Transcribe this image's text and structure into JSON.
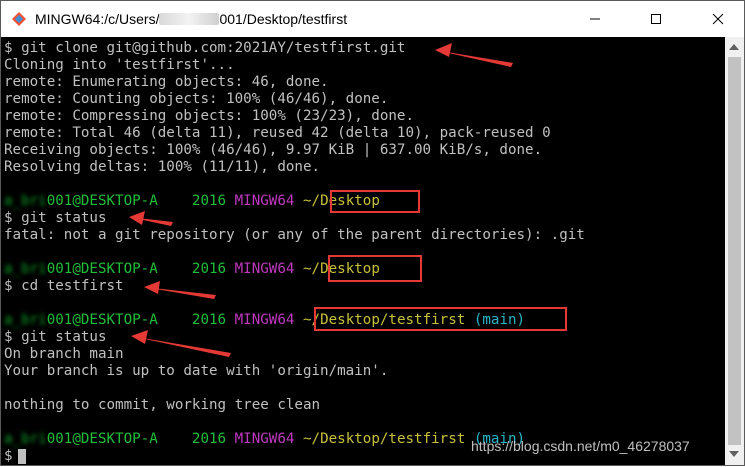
{
  "window": {
    "title_prefix": "MINGW64:/c/Users/",
    "title_suffix": "001/Desktop/testfirst"
  },
  "terminal": {
    "clone_cmd": "$ git clone git@github.com:2021AY/testfirst.git",
    "output": [
      "Cloning into 'testfirst'...",
      "remote: Enumerating objects: 46, done.",
      "remote: Counting objects: 100% (46/46), done.",
      "remote: Compressing objects: 100% (23/23), done.",
      "remote: Total 46 (delta 11), reused 42 (delta 10), pack-reused 0",
      "Receiving objects: 100% (46/46), 9.97 KiB | 637.00 KiB/s, done.",
      "Resolving deltas: 100% (11/11), done."
    ],
    "prompt_user_host": "001@DESKTOP-A    2016",
    "prompt_shell": "MINGW64",
    "prompts": [
      {
        "path": "~/Desktop",
        "branch": ""
      },
      {
        "path": "~/Desktop",
        "branch": ""
      },
      {
        "path": "~/Desktop/testfirst",
        "branch": "(main)"
      },
      {
        "path": "~/Desktop/testfirst",
        "branch": "(main)"
      }
    ],
    "cmd_status1": "$ git status",
    "fatal_msg": "fatal: not a git repository (or any of the parent directories): .git",
    "cmd_cd": "$ cd testfirst",
    "cmd_status2": "$ git status",
    "status_lines": [
      "On branch main",
      "Your branch is up to date with 'origin/main'.",
      "nothing to commit, working tree clean"
    ],
    "input_prompt": "$"
  },
  "watermark": "https://blog.csdn.net/m0_46278037",
  "colors": {
    "background": "#000000",
    "text": "#c0c0c0",
    "user_host": "#1fbf3a",
    "shell": "#c038c0",
    "path": "#c8c038",
    "branch": "#26b6c6",
    "annotation": "#e53935"
  },
  "icons": {
    "app": "git-bash-icon",
    "minimize": "minimize-icon",
    "maximize": "maximize-icon",
    "close": "close-icon"
  }
}
